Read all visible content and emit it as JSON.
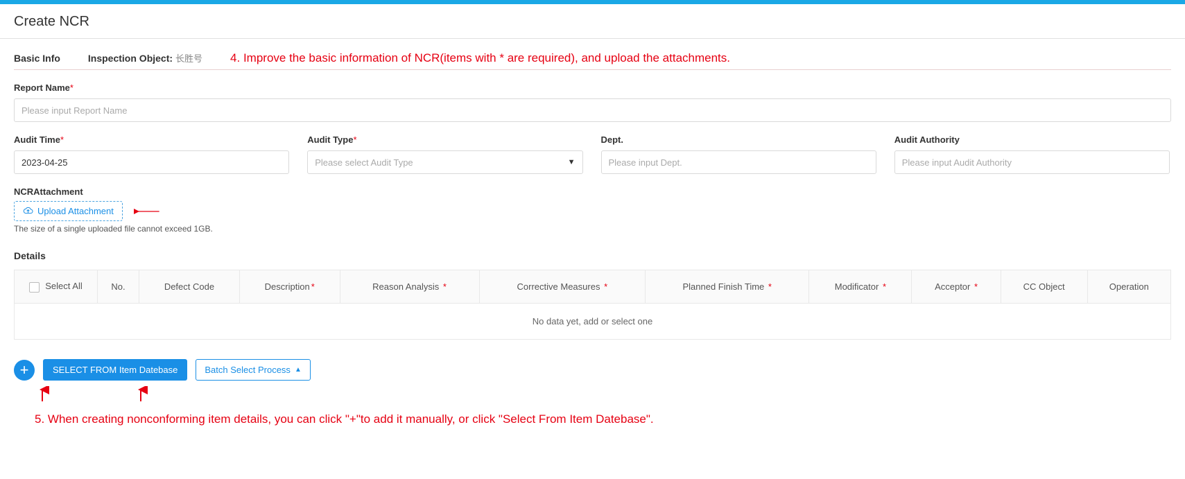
{
  "page": {
    "title": "Create NCR"
  },
  "basic": {
    "section_label": "Basic Info",
    "inspection_label": "Inspection Object:",
    "inspection_value": "长胜号"
  },
  "annotations": {
    "top": "4. Improve the basic information of NCR(items with * are required), and upload the attachments.",
    "bottom": "5. When creating nonconforming item details, you can click \"+\"to add it manually, or click \"Select From Item Datebase\"."
  },
  "fields": {
    "report_name": {
      "label": "Report Name",
      "placeholder": "Please input Report Name",
      "value": ""
    },
    "audit_time": {
      "label": "Audit Time",
      "value": "2023-04-25"
    },
    "audit_type": {
      "label": "Audit Type",
      "placeholder": "Please select Audit Type"
    },
    "dept": {
      "label": "Dept.",
      "placeholder": "Please input Dept."
    },
    "audit_authority": {
      "label": "Audit Authority",
      "placeholder": "Please input Audit Authority"
    }
  },
  "attachment": {
    "section_label": "NCRAttachment",
    "upload_label": "Upload Attachment",
    "hint": "The size of a single uploaded file cannot exceed 1GB."
  },
  "details": {
    "section_label": "Details",
    "columns": {
      "select_all": "Select All",
      "no": "No.",
      "defect_code": "Defect Code",
      "description": "Description",
      "reason_analysis": "Reason Analysis",
      "corrective_measures": "Corrective Measures",
      "planned_finish_time": "Planned Finish Time",
      "modificator": "Modificator",
      "acceptor": "Acceptor",
      "cc_object": "CC Object",
      "operation": "Operation"
    },
    "no_data": "No data yet, add or select one"
  },
  "buttons": {
    "select_from_db": "SELECT FROM Item Datebase",
    "batch_select": "Batch Select Process"
  }
}
